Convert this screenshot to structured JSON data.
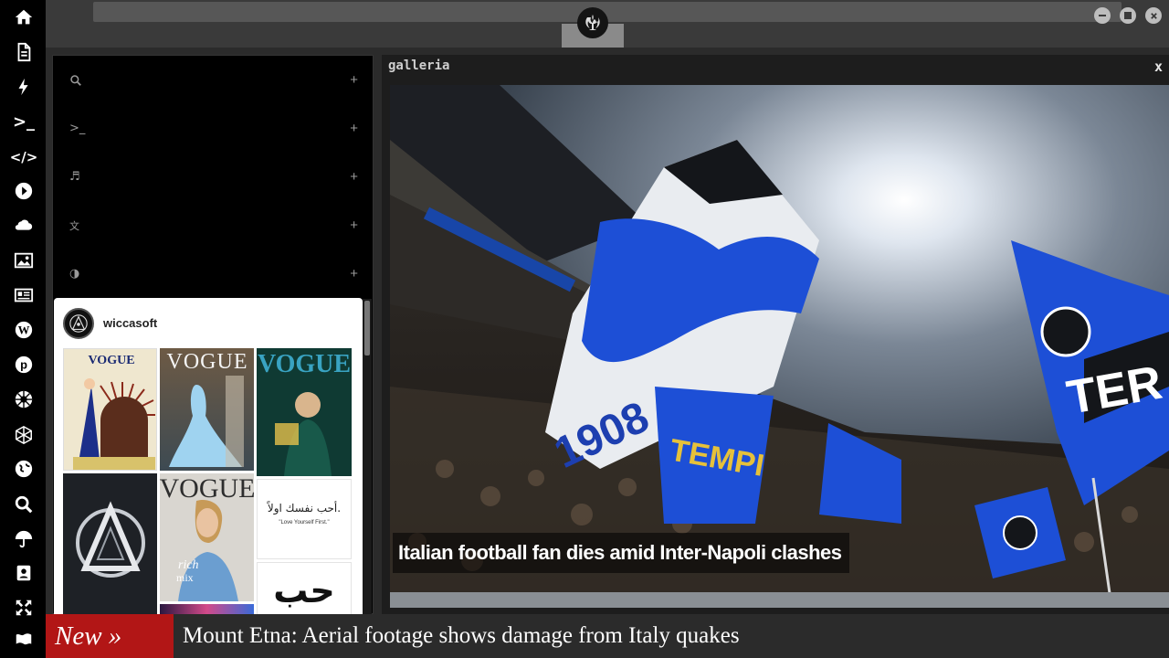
{
  "sidebar": {
    "items": [
      {
        "name": "home-icon"
      },
      {
        "name": "document-icon"
      },
      {
        "name": "lightning-icon"
      },
      {
        "name": "terminal-icon",
        "glyph": ">_"
      },
      {
        "name": "code-icon",
        "glyph": "</>"
      },
      {
        "name": "play-icon"
      },
      {
        "name": "cloud-icon"
      },
      {
        "name": "image-icon"
      },
      {
        "name": "newspaper-icon"
      },
      {
        "name": "wordpress-icon"
      },
      {
        "name": "pinterest-icon"
      },
      {
        "name": "galactic-empire-icon"
      },
      {
        "name": "hexagon-network-icon"
      },
      {
        "name": "globe-icon"
      },
      {
        "name": "search-icon"
      },
      {
        "name": "umbrella-icon"
      },
      {
        "name": "contact-card-icon"
      },
      {
        "name": "expand-icon"
      },
      {
        "name": "flag-icon"
      }
    ]
  },
  "window": {
    "controls": [
      "minimize",
      "maximize",
      "close"
    ],
    "logo": "rebel-alliance-icon"
  },
  "launcher": {
    "rows": [
      {
        "icon": "search-icon",
        "glyph": "🔍",
        "action": "+"
      },
      {
        "icon": "terminal-icon",
        "glyph": ">_",
        "action": "+"
      },
      {
        "icon": "music-icon",
        "glyph": "♬",
        "action": "+"
      },
      {
        "icon": "translate-icon",
        "glyph": "文",
        "action": "+"
      },
      {
        "icon": "contrast-icon",
        "glyph": "◑",
        "action": "+"
      }
    ]
  },
  "instagram": {
    "username": "wiccasoft",
    "tiles": [
      {
        "type": "vogue-art-deco",
        "text": "VOGUE"
      },
      {
        "type": "vogue-gown",
        "text": "VOGUE"
      },
      {
        "type": "vogue-teal",
        "text": "VOGUE"
      },
      {
        "type": "geometric-logo",
        "text": ""
      },
      {
        "type": "vogue-portrait",
        "text": "VOGUE"
      },
      {
        "type": "arabic-quote",
        "text": "أحب نفسك اولاً.",
        "caption": "\"Love Yourself First.\""
      },
      {
        "type": "arabic-word",
        "text": "حب"
      },
      {
        "type": "colorful",
        "text": ""
      }
    ]
  },
  "gallery": {
    "title": "galleria",
    "close_label": "x",
    "headline": "Italian football fan dies amid Inter-Napoli clashes"
  },
  "ticker": {
    "label": "New »",
    "headline": "Mount Etna: Aerial footage shows damage from Italy quakes"
  },
  "colors": {
    "rail_bg": "#000000",
    "panel_bg": "#000000",
    "ticker_label_bg": "#b21616",
    "accent_blue": "#1d4fd6"
  }
}
